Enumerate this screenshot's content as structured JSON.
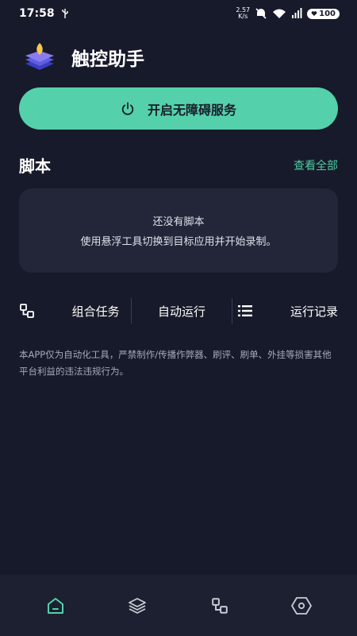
{
  "status_bar": {
    "time": "17:58",
    "net_speed": "2.57",
    "net_unit": "K/s",
    "battery": "100"
  },
  "header": {
    "app_name": "触控助手",
    "logo_icon": "layers-leaf-logo"
  },
  "start_service": {
    "label": "开启无障碍服务",
    "icon": "power-icon"
  },
  "scripts": {
    "title": "脚本",
    "view_all": "查看全部",
    "empty_title": "还没有脚本",
    "empty_desc": "使用悬浮工具切换到目标应用并开始录制。"
  },
  "actions": [
    {
      "label": "组合任务",
      "icon": "combine-icon"
    },
    {
      "label": "自动运行",
      "icon": ""
    },
    {
      "label": "运行记录",
      "icon": "list-icon"
    }
  ],
  "disclaimer": "本APP仅为自动化工具，严禁制作/传播作弊器、刷评、刷单、外挂等损害其他平台利益的违法违规行为。",
  "bottom_nav": [
    {
      "name": "home",
      "icon": "home-icon",
      "active": true
    },
    {
      "name": "layers",
      "icon": "layers-icon",
      "active": false
    },
    {
      "name": "tasks",
      "icon": "combine-icon",
      "active": false
    },
    {
      "name": "settings",
      "icon": "settings-icon",
      "active": false
    }
  ],
  "colors": {
    "accent": "#54d1aa",
    "background": "#171a2a",
    "card": "#232639",
    "link": "#4fcca2"
  }
}
